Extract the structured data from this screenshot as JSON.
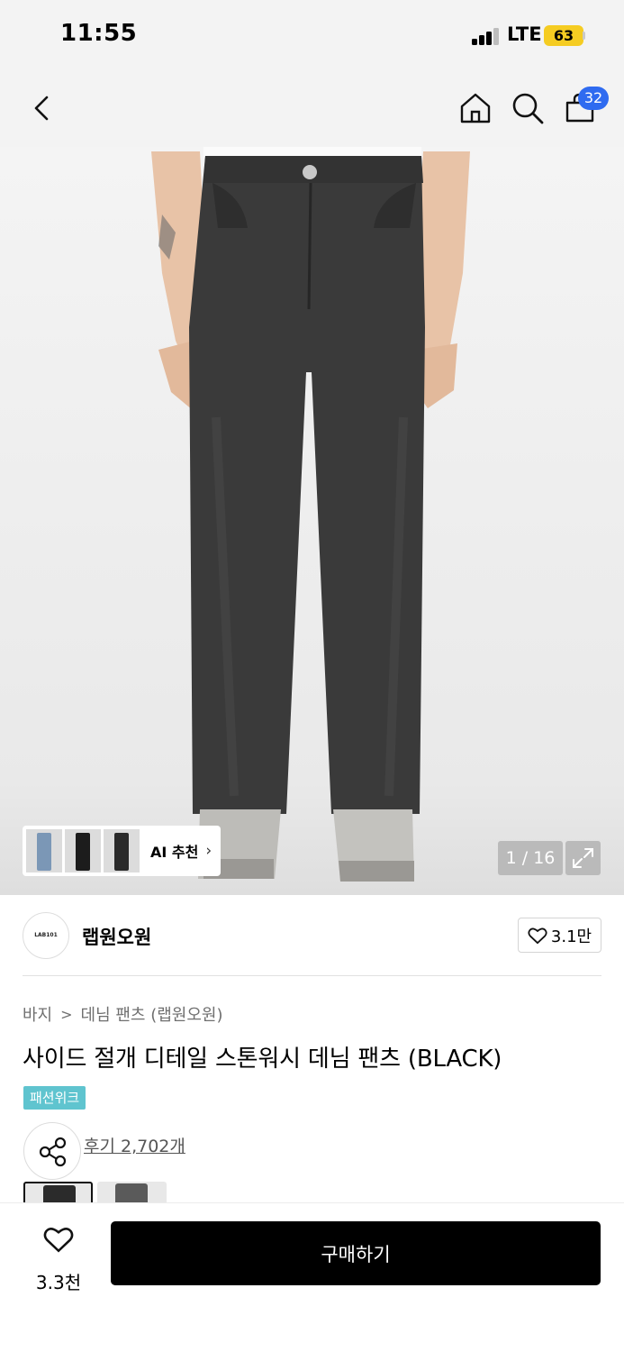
{
  "status_bar": {
    "time": "11:55",
    "network": "LTE",
    "battery": "63"
  },
  "nav": {
    "back_icon": "chevron-left-icon",
    "home_icon": "home-icon",
    "search_icon": "search-icon",
    "cart_icon": "shopping-bag-icon",
    "cart_count": "32"
  },
  "gallery": {
    "ai_recommend_label": "AI 추천",
    "counter": "1 / 16",
    "expand_icon": "expand-icon",
    "thumb_colors": [
      "#7b97b6",
      "#1c1c1c",
      "#2a2a2a"
    ]
  },
  "brand": {
    "logo_text": "LAB101",
    "name": "랩원오원",
    "like_count": "3.1만"
  },
  "breadcrumb": {
    "items": [
      "바지",
      "데님 팬츠 (랩원오원)"
    ],
    "separator": ">"
  },
  "product": {
    "title": "사이드 절개 디테일 스톤워시 데님 팬츠 (BLACK)",
    "badge": "패션위크",
    "review_link": "후기 2,702개"
  },
  "bottom_bar": {
    "wish_count": "3.3천",
    "buy_label": "구매하기"
  },
  "colors": {
    "cart_badge": "#2f6bf0",
    "event_badge": "#5fc4cf",
    "battery": "#f5cc22",
    "buy_button": "#000000"
  }
}
